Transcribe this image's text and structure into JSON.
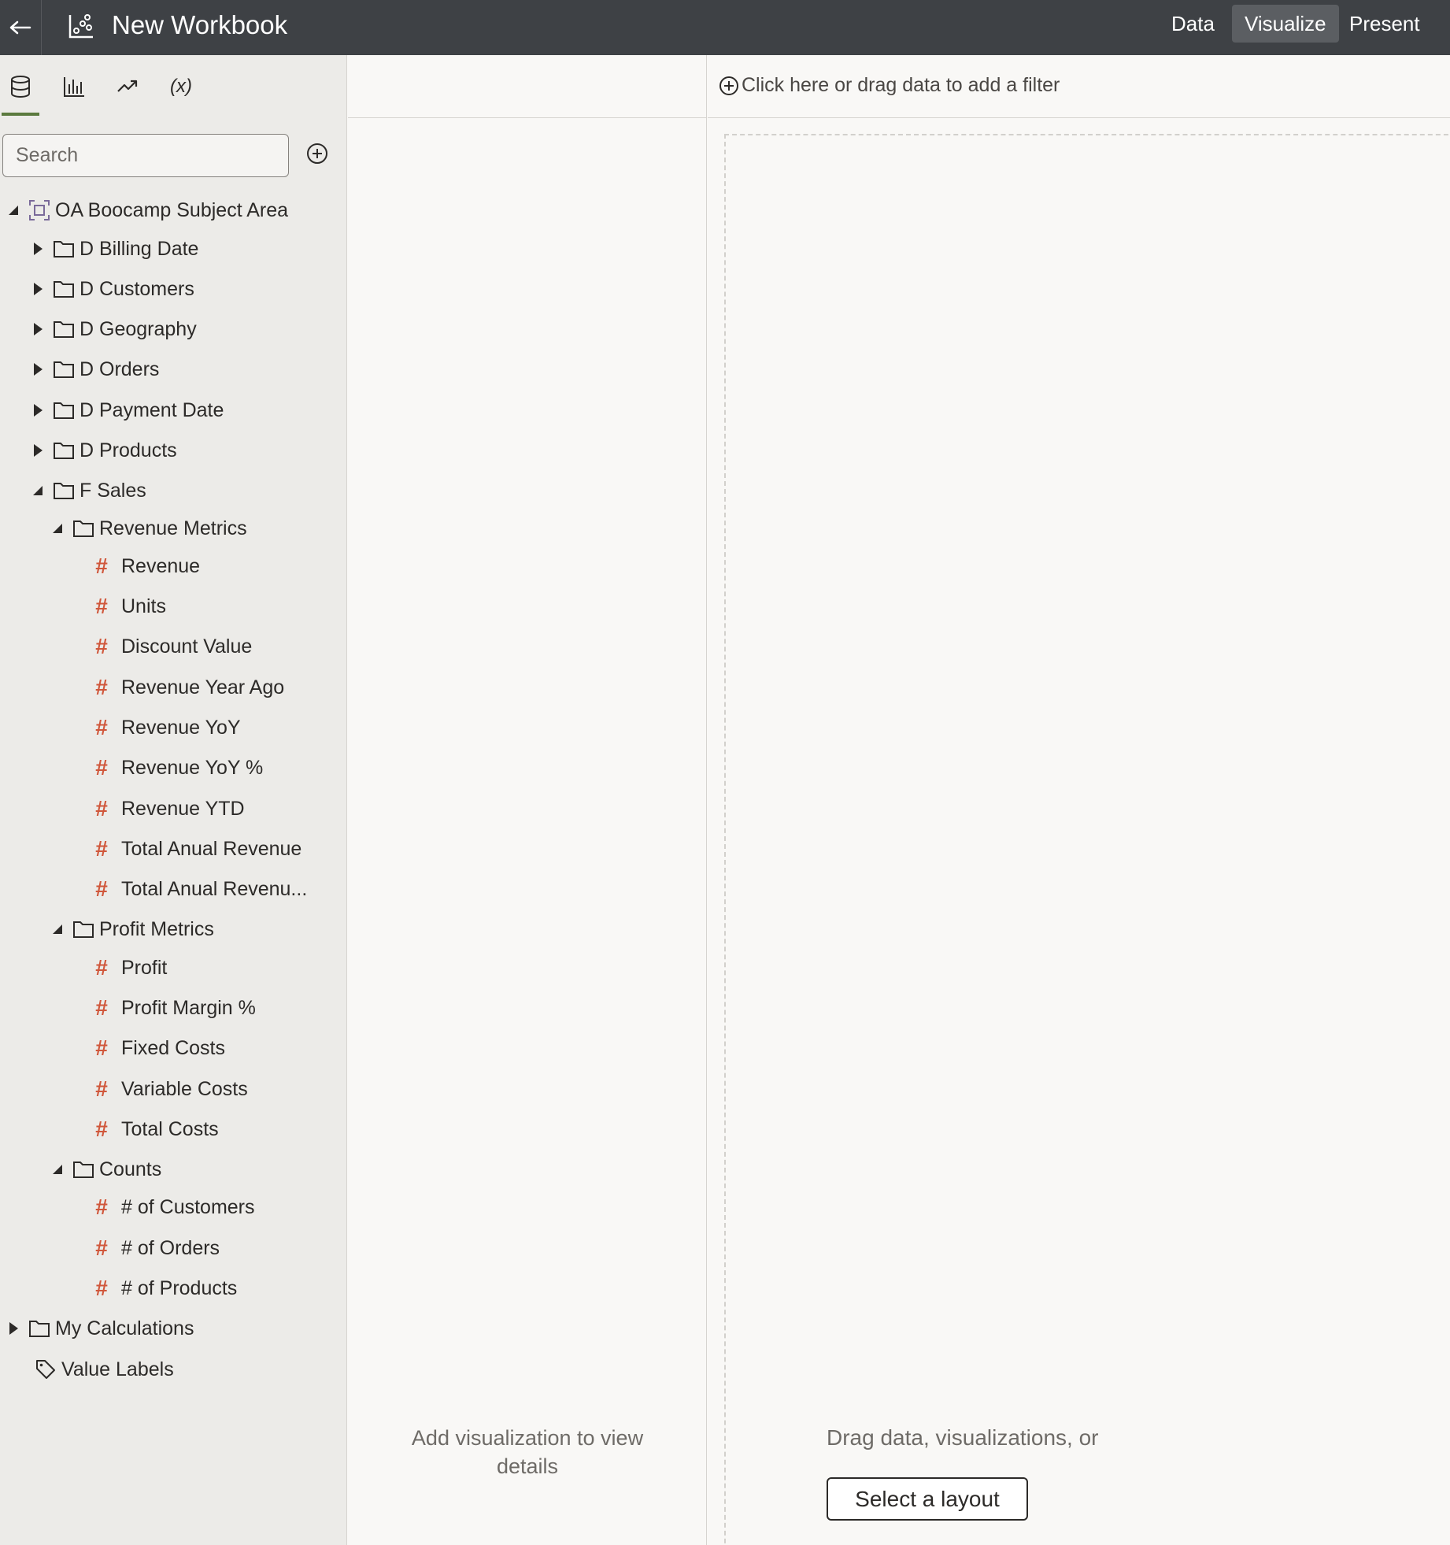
{
  "header": {
    "title": "New Workbook",
    "nav": [
      {
        "label": "Data",
        "active": false
      },
      {
        "label": "Visualize",
        "active": true
      },
      {
        "label": "Present",
        "active": false
      }
    ]
  },
  "left_panel": {
    "tabs": [
      {
        "icon": "database-icon",
        "active": true
      },
      {
        "icon": "bar-chart-icon",
        "active": false
      },
      {
        "icon": "trend-icon",
        "active": false
      },
      {
        "icon": "expression-icon",
        "label": "(x)",
        "active": false
      }
    ],
    "search_placeholder": "Search",
    "tree": {
      "root": "OA Boocamp Subject Area",
      "folders": [
        "D Billing Date",
        "D Customers",
        "D Geography",
        "D Orders",
        "D Payment Date",
        "D Products"
      ],
      "fact": "F Sales",
      "groups": [
        {
          "name": "Revenue Metrics",
          "items": [
            "Revenue",
            "Units",
            "Discount Value",
            "Revenue Year Ago",
            "Revenue YoY",
            "Revenue YoY %",
            "Revenue YTD",
            "Total Anual Revenue",
            "Total Anual Revenu..."
          ]
        },
        {
          "name": "Profit Metrics",
          "items": [
            "Profit",
            "Profit Margin %",
            "Fixed Costs",
            "Variable Costs",
            "Total Costs"
          ]
        },
        {
          "name": "Counts",
          "items": [
            "# of Customers",
            "# of Orders",
            "# of Products"
          ]
        }
      ],
      "my_calculations": "My Calculations",
      "value_labels": "Value Labels"
    }
  },
  "middle_panel": {
    "message": "Add visualization to view details"
  },
  "canvas": {
    "filter_prompt": "Click here or drag data to add a filter",
    "drop_text": "Drag data, visualizations, or",
    "layout_button": "Select a layout"
  },
  "colors": {
    "topbar": "#3e4145",
    "measure_hash": "#d0573b",
    "active_tab_underline": "#5b7a3e"
  }
}
